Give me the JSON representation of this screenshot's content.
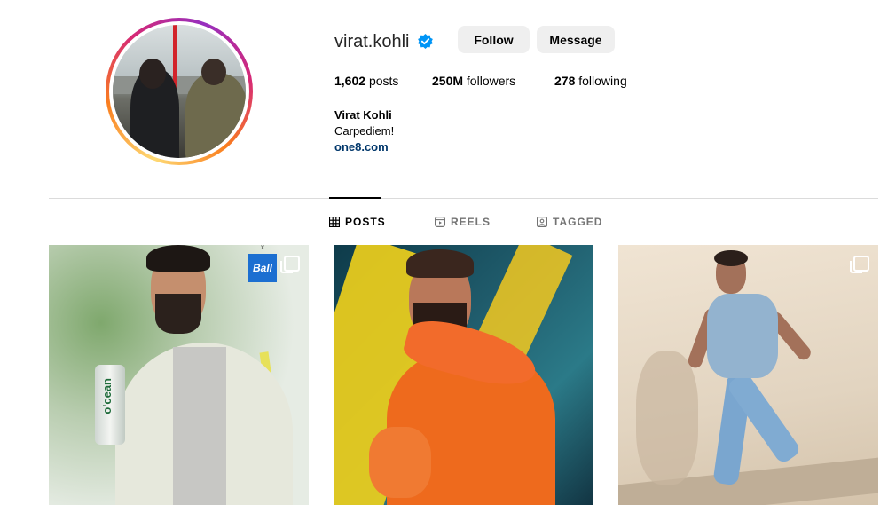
{
  "profile": {
    "username": "virat.kohli",
    "verified": true,
    "follow_label": "Follow",
    "message_label": "Message",
    "stats": {
      "posts_value": "1,602",
      "posts_label": "posts",
      "followers_value": "250M",
      "followers_label": "followers",
      "following_value": "278",
      "following_label": "following"
    },
    "full_name": "Virat Kohli",
    "bio": "Carpediem!",
    "link": "one8.com"
  },
  "tabs": [
    {
      "label": "POSTS",
      "icon": "grid-icon",
      "active": true
    },
    {
      "label": "REELS",
      "icon": "reels-icon",
      "active": false
    },
    {
      "label": "TAGGED",
      "icon": "tagged-icon",
      "active": false
    }
  ],
  "posts": [
    {
      "image": "player holding ocean drink can",
      "can_text": "o'cean",
      "logo_text": "Ball",
      "logo_close": "x",
      "multi": true
    },
    {
      "image": "player holding orange shoes on yellow-blue background",
      "multi": false
    },
    {
      "image": "player running in blue outfit",
      "multi": true
    }
  ],
  "colors": {
    "link": "#00376b",
    "button_bg": "#efefef",
    "verified": "#0095f6",
    "divider": "#dbdbdb",
    "tab_inactive": "#737373"
  }
}
